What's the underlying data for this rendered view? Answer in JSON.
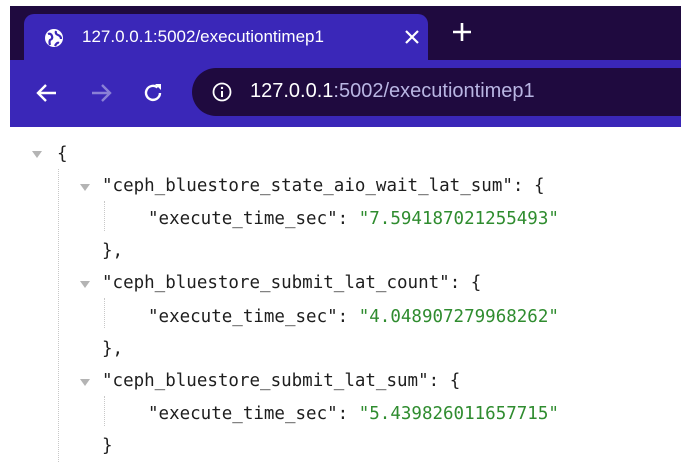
{
  "tab": {
    "title": "127.0.0.1:5002/executiontimep1"
  },
  "address_bar": {
    "host": "127.0.0.1",
    "path": ":5002/executiontimep1"
  },
  "json": {
    "open_brace": "{",
    "entries": [
      {
        "key": "\"ceph_bluestore_state_aio_wait_lat_sum\"",
        "field": "\"execute_time_sec\"",
        "value": "\"7.594187021255493\"",
        "close": "},"
      },
      {
        "key": "\"ceph_bluestore_submit_lat_count\"",
        "field": "\"execute_time_sec\"",
        "value": "\"4.048907279968262\"",
        "close": "},"
      },
      {
        "key": "\"ceph_bluestore_submit_lat_sum\"",
        "field": "\"execute_time_sec\"",
        "value": "\"5.439826011657715\"",
        "close": "}"
      }
    ],
    "colon": ": ",
    "open_obj": "{"
  },
  "colors": {
    "tab_bg": "#3a27b8",
    "strip_bg": "#1f0a3f",
    "string_value": "#2f8c2f"
  }
}
